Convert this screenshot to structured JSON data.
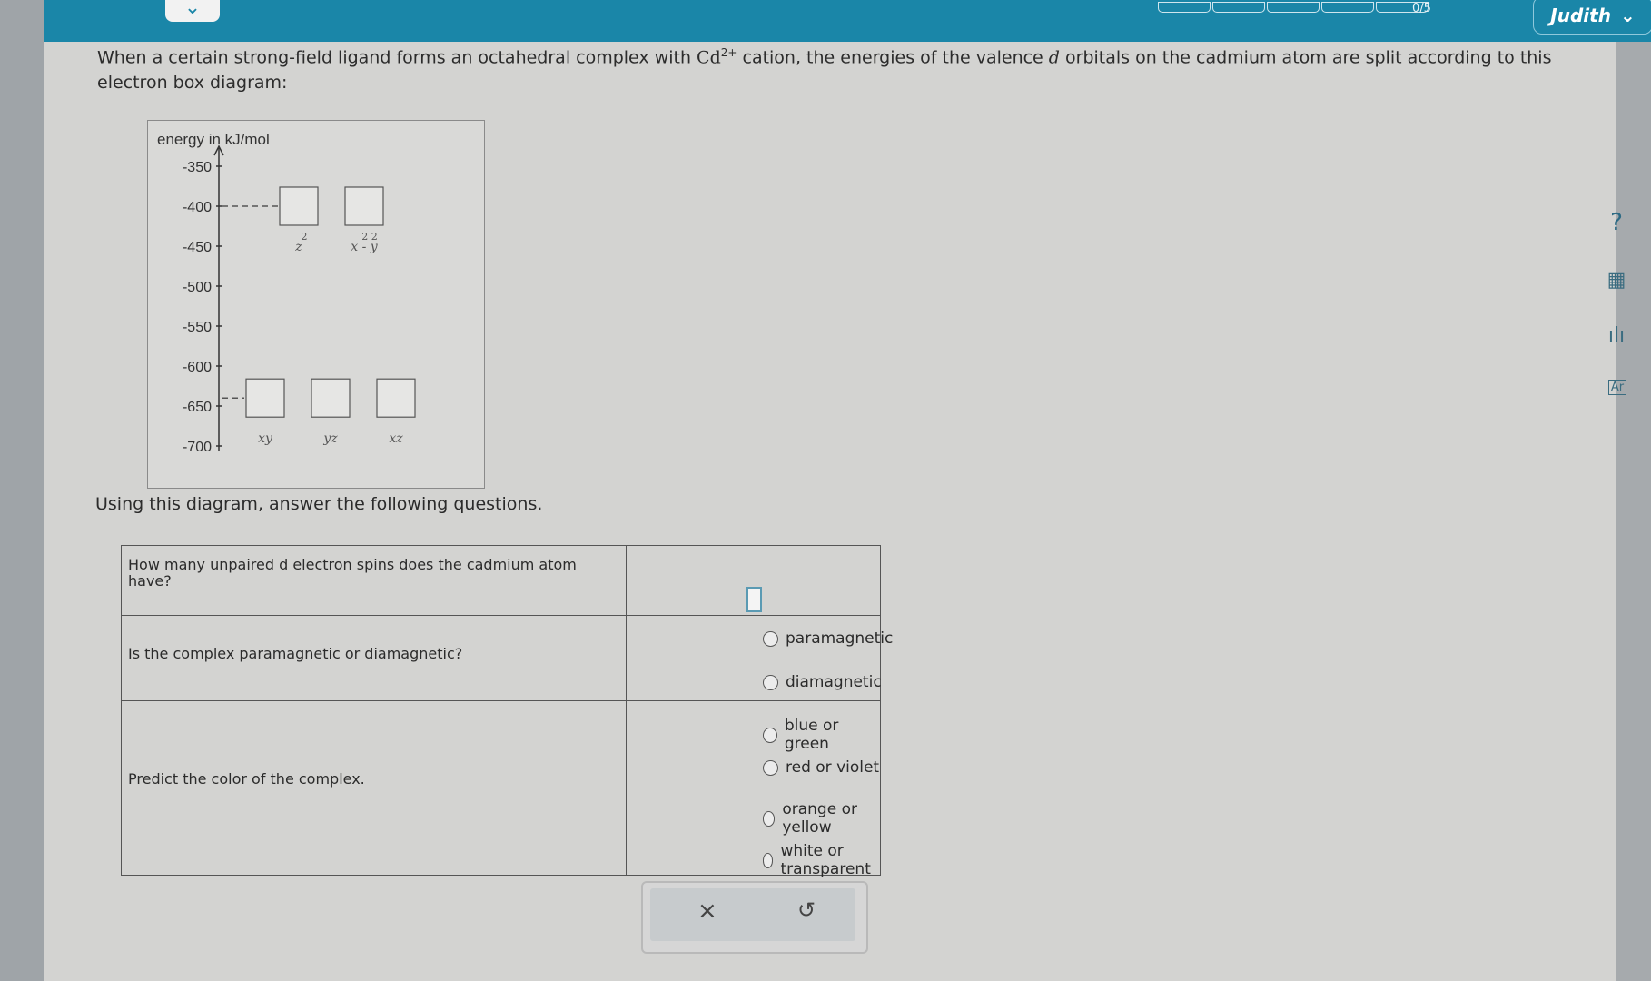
{
  "topbar": {
    "collapse_icon": "chevron-down-icon",
    "progress_label": "0/5",
    "user_name": "Judith",
    "user_menu_icon": "chevron-down-icon"
  },
  "question": {
    "intro_part1": "When a certain strong-field ligand forms an octahedral complex with ",
    "cation_symbol": "Cd",
    "cation_charge": "2+",
    "intro_part2": " cation, the energies of the valence ",
    "d_symbol": "d",
    "intro_part3": " orbitals on the cadmium atom are split according to this electron box diagram:",
    "prompt": "Using this diagram, answer the following questions."
  },
  "diagram": {
    "axis_label": "energy in kJ/mol",
    "ticks": [
      "-350",
      "-400",
      "-450",
      "-500",
      "-550",
      "-600",
      "-650",
      "-700"
    ],
    "upper_orbitals": [
      {
        "label": "z",
        "superscript": "2"
      },
      {
        "label": "x - y",
        "superscript": "2 2"
      }
    ],
    "upper_energy": -400,
    "lower_orbitals": [
      {
        "label": "xy"
      },
      {
        "label": "yz"
      },
      {
        "label": "xz"
      }
    ],
    "lower_energy": -640
  },
  "questions": [
    {
      "text": "How many unpaired d electron spins does the cadmium atom have?",
      "input_value": ""
    },
    {
      "text": "Is the complex paramagnetic or diamagnetic?",
      "options": [
        "paramagnetic",
        "diamagnetic"
      ]
    },
    {
      "text": "Predict the color of the complex.",
      "options": [
        "blue or green",
        "red or violet",
        "orange or yellow",
        "white or transparent"
      ]
    }
  ],
  "actions": {
    "clear_icon": "close-icon",
    "clear_glyph": "×",
    "undo_icon": "undo-icon",
    "undo_glyph": "↺"
  },
  "right_tools": [
    {
      "name": "help-icon",
      "glyph": "?"
    },
    {
      "name": "calculator-icon",
      "glyph": "▦"
    },
    {
      "name": "data-chart-icon",
      "glyph": "ılı"
    },
    {
      "name": "periodic-table-icon",
      "glyph": "Ar"
    }
  ]
}
